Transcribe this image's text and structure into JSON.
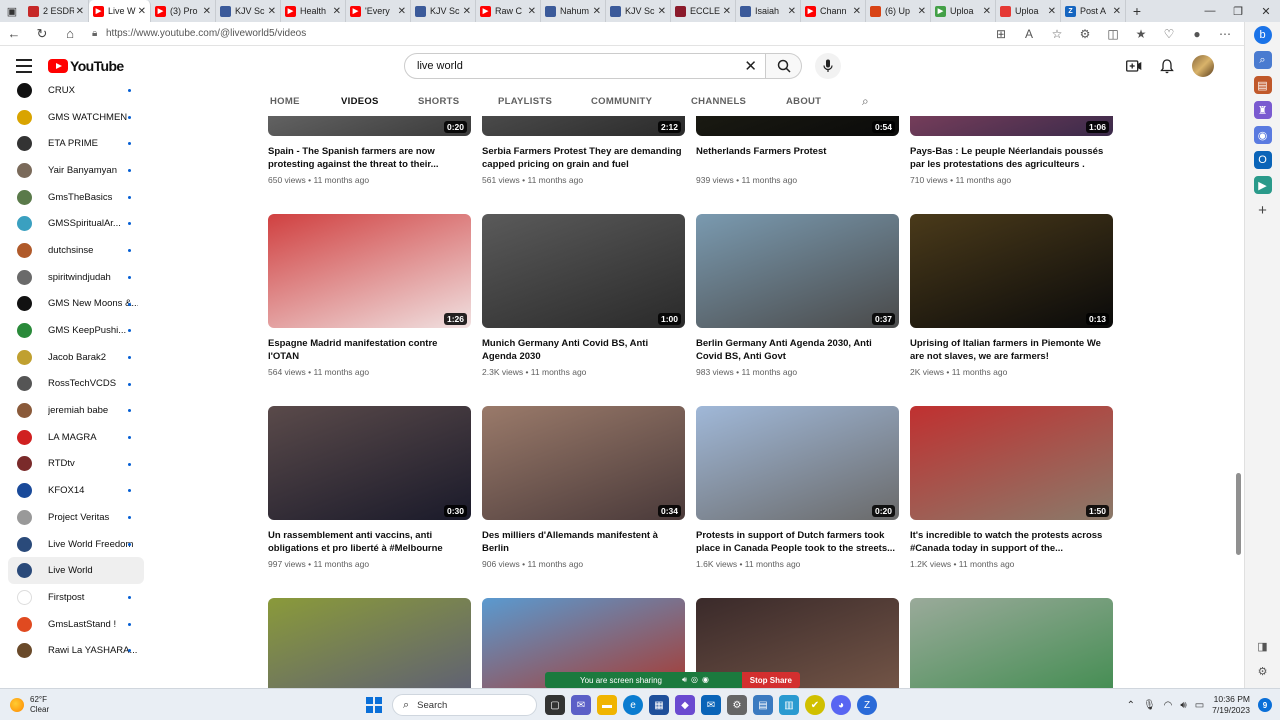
{
  "browser": {
    "tabs": [
      {
        "label": "2 ESDR",
        "color": "#c62828",
        "glyph": "",
        "active": false
      },
      {
        "label": "Live W",
        "color": "#ff0000",
        "glyph": "▶",
        "active": true
      },
      {
        "label": "(3) Pro",
        "color": "#ff0000",
        "glyph": "▶",
        "active": false
      },
      {
        "label": "KJV Sc",
        "color": "#3b5a9a",
        "glyph": "",
        "active": false
      },
      {
        "label": "Health",
        "color": "#ff0000",
        "glyph": "▶",
        "active": false
      },
      {
        "label": "'Every",
        "color": "#ff0000",
        "glyph": "▶",
        "active": false
      },
      {
        "label": "KJV Sc",
        "color": "#3b5a9a",
        "glyph": "",
        "active": false
      },
      {
        "label": "Raw C",
        "color": "#ff0000",
        "glyph": "▶",
        "active": false
      },
      {
        "label": "Nahum",
        "color": "#3b5a9a",
        "glyph": "",
        "active": false
      },
      {
        "label": "KJV Sc",
        "color": "#3b5a9a",
        "glyph": "",
        "active": false
      },
      {
        "label": "ECCLE",
        "color": "#8b1a2b",
        "glyph": "",
        "active": false
      },
      {
        "label": "Isaiah",
        "color": "#3b5a9a",
        "glyph": "",
        "active": false
      },
      {
        "label": "Chann",
        "color": "#ff0000",
        "glyph": "▶",
        "active": false
      },
      {
        "label": "(6) Up",
        "color": "#d84315",
        "glyph": "",
        "active": false
      },
      {
        "label": "Uploa",
        "color": "#43a047",
        "glyph": "▶",
        "active": false
      },
      {
        "label": "Uploa",
        "color": "#e53935",
        "glyph": "",
        "active": false
      },
      {
        "label": "Post A",
        "color": "#1565c0",
        "glyph": "Z",
        "active": false
      }
    ],
    "url": "https://www.youtube.com/@liveworld5/videos"
  },
  "header": {
    "logo_text": "YouTube",
    "search_value": "live world"
  },
  "guide": {
    "items": [
      {
        "name": "CRUX",
        "color": "#111111",
        "active": false
      },
      {
        "name": "GMS WATCHMEN",
        "color": "#d9a400",
        "active": false
      },
      {
        "name": "ETA PRIME",
        "color": "#333333",
        "active": false
      },
      {
        "name": "Yair Banyamyan",
        "color": "#7a6a5a",
        "active": false
      },
      {
        "name": "GmsTheBasics",
        "color": "#5a7a4a",
        "active": false
      },
      {
        "name": "GMSSpiritualAr...",
        "color": "#3aa0c0",
        "active": false
      },
      {
        "name": "dutchsinse",
        "color": "#b05a2a",
        "active": false
      },
      {
        "name": "spiritwindjudah",
        "color": "#6a6a6a",
        "active": false
      },
      {
        "name": "GMS New Moons &...",
        "color": "#111111",
        "active": false
      },
      {
        "name": "GMS KeepPushi...",
        "color": "#2a8a3a",
        "active": false
      },
      {
        "name": "Jacob Barak2",
        "color": "#c0a030",
        "active": false
      },
      {
        "name": "RossTechVCDS",
        "color": "#555555",
        "active": false
      },
      {
        "name": "jeremiah babe",
        "color": "#8a5a3a",
        "active": false
      },
      {
        "name": "LA MAGRA",
        "color": "#d02020",
        "active": false
      },
      {
        "name": "RTDtv",
        "color": "#7a2a2a",
        "active": false
      },
      {
        "name": "KFOX14",
        "color": "#1a4a9a",
        "active": false
      },
      {
        "name": "Project Veritas",
        "color": "#999999",
        "active": false
      },
      {
        "name": "Live World Freedom",
        "color": "#2a4a7a",
        "active": false
      },
      {
        "name": "Live World",
        "color": "#2a4a7a",
        "active": true
      },
      {
        "name": "Firstpost",
        "color": "#ffffff",
        "active": false
      },
      {
        "name": "GmsLastStand !",
        "color": "#e04a20",
        "active": false
      },
      {
        "name": "Rawi La YASHARA...",
        "color": "#6a4a2a",
        "active": false
      }
    ]
  },
  "channel_tabs": [
    {
      "label": "HOME",
      "selected": false
    },
    {
      "label": "VIDEOS",
      "selected": true
    },
    {
      "label": "SHORTS",
      "selected": false
    },
    {
      "label": "PLAYLISTS",
      "selected": false
    },
    {
      "label": "COMMUNITY",
      "selected": false
    },
    {
      "label": "CHANNELS",
      "selected": false
    },
    {
      "label": "ABOUT",
      "selected": false
    }
  ],
  "videos": [
    {
      "title": "Spain - The Spanish farmers are now protesting against the threat to their...",
      "meta": "650 views • 11 months ago",
      "duration": "0:20",
      "c1": "#8a8a8a",
      "c2": "#3a3a3a"
    },
    {
      "title": "Serbia Farmers Protest They are demanding capped pricing on grain and fuel",
      "meta": "561 views • 11 months ago",
      "duration": "2:12",
      "c1": "#6a6a6a",
      "c2": "#2a2a2a"
    },
    {
      "title": "Netherlands Farmers Protest",
      "meta": "939 views • 11 months ago",
      "duration": "0:54",
      "c1": "#2a2a1a",
      "c2": "#0a0a0a"
    },
    {
      "title": "Pays-Bas : Le peuple Néerlandais poussés par les protestations des agriculteurs .",
      "meta": "710 views • 11 months ago",
      "duration": "1:06",
      "c1": "#b0506a",
      "c2": "#3a2a4a"
    },
    {
      "title": "Espagne Madrid manifestation contre l'OTAN",
      "meta": "564 views • 11 months ago",
      "duration": "1:26",
      "c1": "#d04040",
      "c2": "#f0e0e0"
    },
    {
      "title": "Munich Germany Anti Covid BS, Anti Agenda 2030",
      "meta": "2.3K views • 11 months ago",
      "duration": "1:00",
      "c1": "#5a5a5a",
      "c2": "#2a2a2a"
    },
    {
      "title": "Berlin Germany Anti Agenda 2030, Anti Covid BS, Anti Govt",
      "meta": "983 views • 11 months ago",
      "duration": "0:37",
      "c1": "#7a9ab0",
      "c2": "#4a4a4a"
    },
    {
      "title": "Uprising of Italian farmers in Piemonte We are not slaves, we are farmers!",
      "meta": "2K views • 11 months ago",
      "duration": "0:13",
      "c1": "#4a3a1a",
      "c2": "#0a0a0a"
    },
    {
      "title": "Un rassemblement anti vaccins, anti obligations et pro liberté à #Melbourne",
      "meta": "997 views • 11 months ago",
      "duration": "0:30",
      "c1": "#5a4a4a",
      "c2": "#1a1a2a"
    },
    {
      "title": "Des milliers d'Allemands manifestent à Berlin",
      "meta": "906 views • 11 months ago",
      "duration": "0:34",
      "c1": "#9a7a6a",
      "c2": "#4a3a3a"
    },
    {
      "title": "Protests in support of Dutch farmers took place in Canada People took to the streets...",
      "meta": "1.6K views • 11 months ago",
      "duration": "0:20",
      "c1": "#a0b8d8",
      "c2": "#6a6a6a"
    },
    {
      "title": "It's incredible to watch the protests across #Canada today in support of the...",
      "meta": "1.2K views • 11 months ago",
      "duration": "1:50",
      "c1": "#c03030",
      "c2": "#8a7a6a"
    },
    {
      "title": "",
      "meta": "",
      "duration": "",
      "c1": "#8a9a3a",
      "c2": "#5a5a7a"
    },
    {
      "title": "",
      "meta": "",
      "duration": "",
      "c1": "#5a9ad0",
      "c2": "#b03020"
    },
    {
      "title": "",
      "meta": "",
      "duration": "",
      "c1": "#3a2a2a",
      "c2": "#7a5a4a"
    },
    {
      "title": "",
      "meta": "",
      "duration": "",
      "c1": "#9aaa9a",
      "c2": "#3a8a4a"
    }
  ],
  "screen_share": {
    "label": "You are screen sharing",
    "stop_label": "Stop Share"
  },
  "taskbar": {
    "temperature": "62°F",
    "condition": "Clear",
    "search_placeholder": "Search",
    "time": "10:36 PM",
    "date": "7/19/2023",
    "notification_count": "9"
  }
}
